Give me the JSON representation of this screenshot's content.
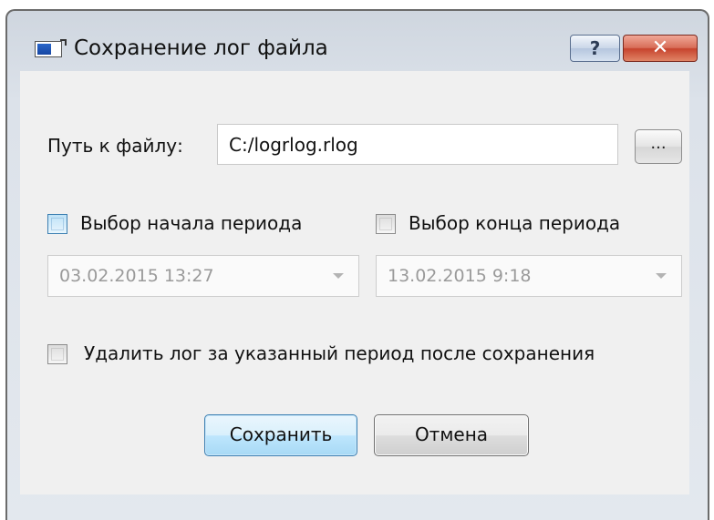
{
  "window": {
    "title": "Сохранение лог файла",
    "help_label": "?",
    "close_label": "✕"
  },
  "path": {
    "label": "Путь к файлу:",
    "value": "C:/logrlog.rlog",
    "browse_label": "..."
  },
  "period_start": {
    "checkbox_label": "Выбор начала периода",
    "checked": false,
    "value": "03.02.2015 13:27"
  },
  "period_end": {
    "checkbox_label": "Выбор конца периода",
    "checked": false,
    "value": "13.02.2015 9:18"
  },
  "delete_option": {
    "checkbox_label": "Удалить лог за указанный период после сохранения",
    "checked": false
  },
  "buttons": {
    "save_label": "Сохранить",
    "cancel_label": "Отмена"
  },
  "colors": {
    "accent_border": "#3c7fb1",
    "close_red": "#c7432d",
    "dialog_bg": "#f0f0f0",
    "disabled_text": "#9a9a9a"
  },
  "icons": {
    "app": "app-window-icon",
    "close": "close-icon",
    "help": "help-icon",
    "dropdown": "chevron-down-icon"
  }
}
